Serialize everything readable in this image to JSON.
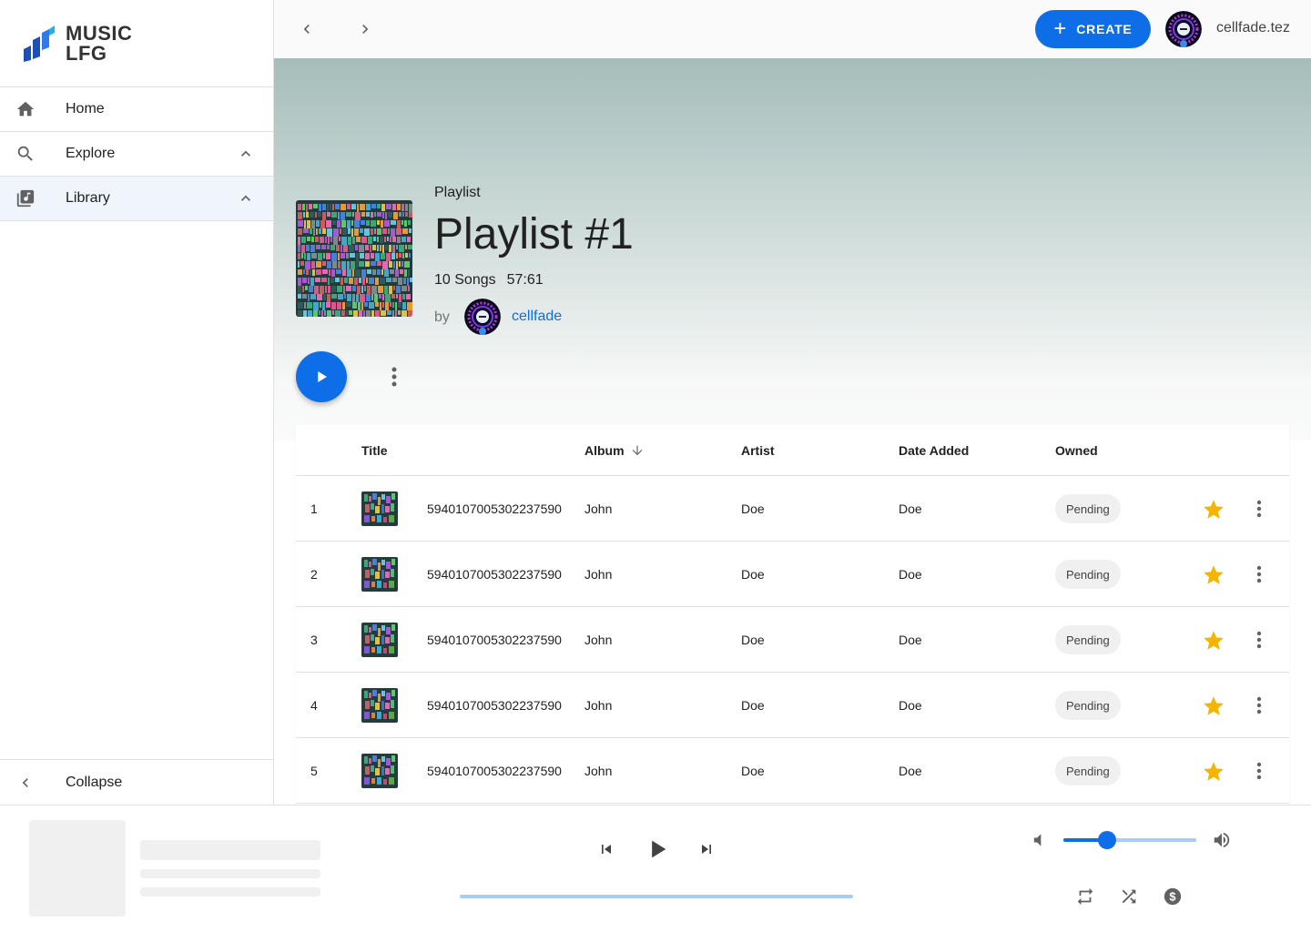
{
  "app": {
    "logo_line1": "MUSIC",
    "logo_line2": "LFG",
    "accent": "#0d6ee8"
  },
  "sidebar": {
    "items": [
      {
        "label": "Home",
        "icon": "home-icon"
      },
      {
        "label": "Explore",
        "icon": "search-icon",
        "expanded": true
      },
      {
        "label": "Library",
        "icon": "library-music-icon",
        "expanded": true,
        "active": true
      }
    ],
    "collapse_label": "Collapse"
  },
  "topbar": {
    "create_label": "CREATE",
    "user_name": "cellfade.tez"
  },
  "playlist": {
    "type": "Playlist",
    "title": "Playlist #1",
    "song_count": "10 Songs",
    "duration": "57:61",
    "by_label": "by",
    "owner": "cellfade"
  },
  "table": {
    "headers": {
      "title": "Title",
      "album": "Album",
      "artist": "Artist",
      "date_added": "Date Added",
      "owned": "Owned"
    },
    "sort": {
      "column": "album",
      "direction": "descending"
    },
    "rows": [
      {
        "index": "1",
        "title": "5940107005302237590",
        "album": "John",
        "artist": "Doe",
        "date_added": "Doe",
        "owned": "Pending",
        "starred": true
      },
      {
        "index": "2",
        "title": "5940107005302237590",
        "album": "John",
        "artist": "Doe",
        "date_added": "Doe",
        "owned": "Pending",
        "starred": true
      },
      {
        "index": "3",
        "title": "5940107005302237590",
        "album": "John",
        "artist": "Doe",
        "date_added": "Doe",
        "owned": "Pending",
        "starred": true
      },
      {
        "index": "4",
        "title": "5940107005302237590",
        "album": "John",
        "artist": "Doe",
        "date_added": "Doe",
        "owned": "Pending",
        "starred": true
      },
      {
        "index": "5",
        "title": "5940107005302237590",
        "album": "John",
        "artist": "Doe",
        "date_added": "Doe",
        "owned": "Pending",
        "starred": true
      }
    ]
  },
  "player": {
    "volume_fraction": 0.33,
    "progress_fraction": 0
  }
}
